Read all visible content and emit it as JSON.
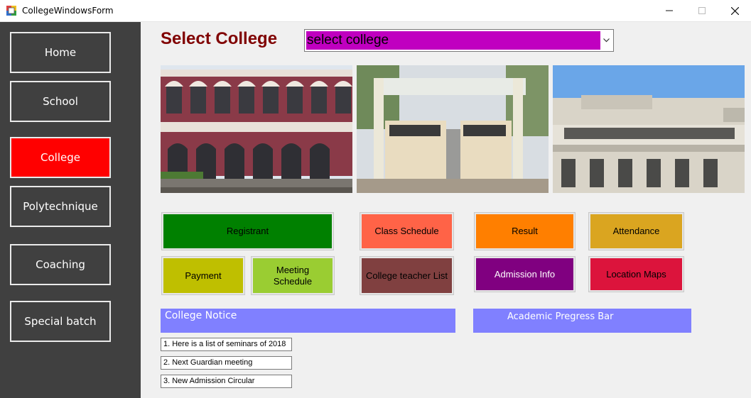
{
  "window": {
    "title": "CollegeWindowsForm"
  },
  "sidebar": {
    "items": [
      {
        "label": "Home"
      },
      {
        "label": "School"
      },
      {
        "label": "College"
      },
      {
        "label": "Polytechnique"
      },
      {
        "label": "Coaching"
      },
      {
        "label": "Special batch"
      }
    ],
    "active_color": "#ff0000",
    "background": "#404040"
  },
  "header": {
    "title": "Select College",
    "combo_value": "select college",
    "combo_color": "#c000c0"
  },
  "photos": [
    {
      "caption": ""
    },
    {
      "caption": ""
    },
    {
      "caption": ""
    }
  ],
  "actions": {
    "registrant": {
      "label": "Registrant",
      "color": "#008000"
    },
    "class_schedule": {
      "label": "Class Schedule",
      "color": "#ff6347"
    },
    "result": {
      "label": "Result",
      "color": "#ff7f00"
    },
    "attendance": {
      "label": "Attendance",
      "color": "#daa520"
    },
    "payment": {
      "label": "Payment",
      "color": "#bfbf00"
    },
    "meeting_schedule": {
      "label": "Meeting Schedule",
      "color": "#9acd32"
    },
    "teacher_list": {
      "label": "College teacher List",
      "color": "#804040"
    },
    "admission_info": {
      "label": "Admission Info",
      "color": "#800080"
    },
    "location_maps": {
      "label": "Location Maps",
      "color": "#dc143c"
    }
  },
  "notice": {
    "title": "College Notice",
    "items": [
      "1. Here is a list of seminars of 2018",
      "2. Next Guardian meeting",
      "3. New Admission Circular"
    ]
  },
  "progress": {
    "title": "Academic Pregress Bar"
  }
}
